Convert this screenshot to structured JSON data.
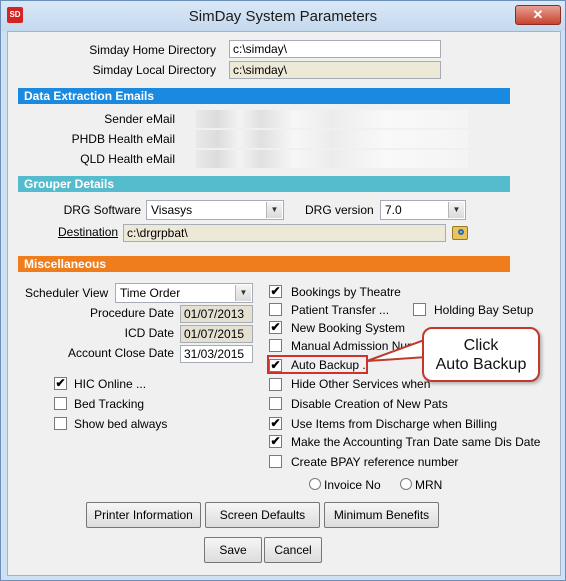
{
  "window": {
    "title": "SimDay System Parameters",
    "icon_text": "SD",
    "close_label": "✕"
  },
  "directories": {
    "home_label": "Simday Home Directory",
    "home_value": "c:\\simday\\",
    "local_label": "Simday Local Directory",
    "local_value": "c:\\simday\\"
  },
  "sections": {
    "emails": "Data Extraction Emails",
    "grouper": "Grouper Details",
    "misc": "Miscellaneous"
  },
  "emails": {
    "sender_label": "Sender eMail",
    "phdb_label": "PHDB Health eMail",
    "qld_label": "QLD Health eMail"
  },
  "grouper": {
    "drg_software_label": "DRG Software",
    "drg_software_value": "Visasys",
    "drg_version_label": "DRG version",
    "drg_version_value": "7.0",
    "destination_label": "Destination",
    "destination_value": "c:\\drgrpbat\\"
  },
  "misc": {
    "scheduler_view_label": "Scheduler View",
    "scheduler_view_value": "Time Order",
    "procedure_date_label": "Procedure Date",
    "procedure_date_value": "01/07/2013",
    "icd_date_label": "ICD Date",
    "icd_date_value": "01/07/2015",
    "account_close_label": "Account Close Date",
    "account_close_value": "31/03/2015"
  },
  "left_checks": [
    {
      "label": "HIC Online ...",
      "checked": true
    },
    {
      "label": "Bed Tracking",
      "checked": false
    },
    {
      "label": "Show bed always",
      "checked": false
    }
  ],
  "right_checks": {
    "bookings_by_theatre": {
      "label": "Bookings by Theatre",
      "checked": true
    },
    "patient_transfer": {
      "label": "Patient Transfer ...",
      "checked": false
    },
    "holding_bay": {
      "label": "Holding Bay Setup",
      "checked": false
    },
    "new_booking": {
      "label": "New Booking System",
      "checked": true
    },
    "manual_admission": {
      "label": "Manual Admission Num",
      "checked": false
    },
    "auto_backup": {
      "label": "Auto Backup ..",
      "checked": true
    },
    "hide_other": {
      "label": "Hide Other Services when",
      "checked": false
    },
    "disable_creation": {
      "label": "Disable Creation of New Pats",
      "checked": false
    },
    "use_items": {
      "label": "Use Items from Discharge when Billing",
      "checked": true
    },
    "make_accounting": {
      "label": "Make the Accounting Tran Date same Dis Date",
      "checked": true
    },
    "create_bpay": {
      "label": "Create BPAY reference number",
      "checked": false
    }
  },
  "radios": {
    "invoice_no": "Invoice No",
    "mrn": "MRN"
  },
  "buttons": {
    "printer_info": "Printer Information",
    "screen_defaults": "Screen Defaults",
    "minimum_benefits": "Minimum Benefits",
    "save": "Save",
    "cancel": "Cancel"
  },
  "callout": {
    "line1": "Click",
    "line2": "Auto Backup"
  },
  "colors": {
    "band_blue": "#1a8ae0",
    "band_cyan": "#55bccd",
    "band_orange": "#f07d1c",
    "highlight_red": "#d0312d"
  }
}
